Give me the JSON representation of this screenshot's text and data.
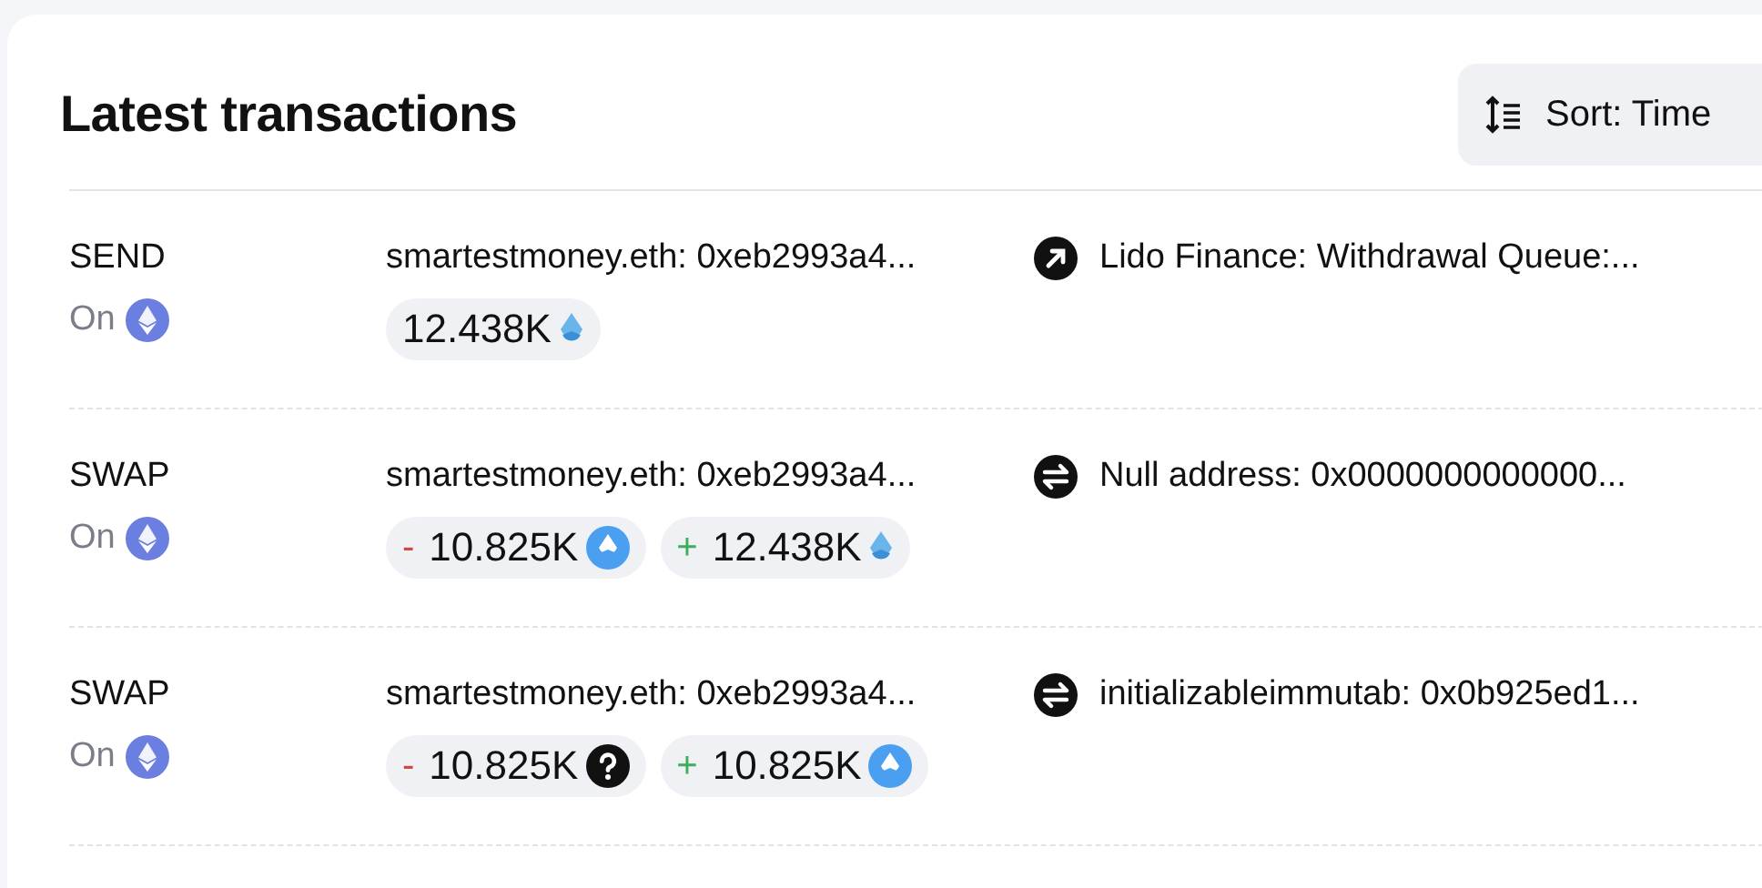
{
  "header": {
    "title": "Latest transactions",
    "sort_button": {
      "label": "Sort: Time"
    }
  },
  "transactions": [
    {
      "kind": "send",
      "type": "SEND",
      "chain_label": "On",
      "from": "smartestmoney.eth: 0xeb2993a4...",
      "to": "Lido Finance: Withdrawal Queue:...",
      "amounts": [
        {
          "kind": "drop",
          "value": "12.438K"
        }
      ]
    },
    {
      "kind": "swap",
      "type": "SWAP",
      "chain_label": "On",
      "from": "smartestmoney.eth: 0xeb2993a4...",
      "to": "Null address: 0x0000000000000...",
      "amounts": [
        {
          "kind": "coin",
          "color": "#d0443a",
          "sign": "-",
          "value": "10.825K"
        },
        {
          "kind": "drop",
          "color": "#3fae5a",
          "sign": "+",
          "value": "12.438K"
        }
      ]
    },
    {
      "kind": "swap",
      "type": "SWAP",
      "chain_label": "On",
      "from": "smartestmoney.eth: 0xeb2993a4...",
      "to": "initializableimmutab: 0x0b925ed1...",
      "amounts": [
        {
          "kind": "unknown",
          "color": "#d0443a",
          "sign": "-",
          "value": "10.825K"
        },
        {
          "kind": "coin",
          "color": "#3fae5a",
          "sign": "+",
          "value": "10.825K"
        }
      ]
    }
  ]
}
